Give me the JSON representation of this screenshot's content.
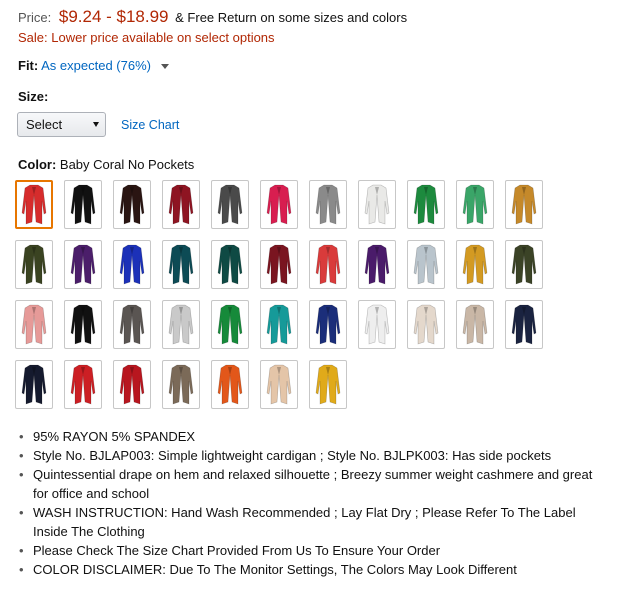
{
  "price": {
    "label": "Price:",
    "range": "$9.24 - $18.99",
    "free_return": "& Free Return on some sizes and colors"
  },
  "sale": {
    "text": "Sale:  Lower price available on select options"
  },
  "fit": {
    "label": "Fit:",
    "value": "As expected (76%)"
  },
  "size": {
    "label": "Size:",
    "select_value": "Select",
    "size_chart": "Size Chart"
  },
  "color": {
    "label": "Color:",
    "selected_name": "Baby Coral No Pockets"
  },
  "swatches": [
    {
      "color": "#d62c2c",
      "selected": true
    },
    {
      "color": "#111111"
    },
    {
      "color": "#2a1512"
    },
    {
      "color": "#8e1422"
    },
    {
      "color": "#4a4a4a"
    },
    {
      "color": "#d81e50"
    },
    {
      "color": "#8a8a8a"
    },
    {
      "color": "#e9e9e7"
    },
    {
      "color": "#1d8a3e"
    },
    {
      "color": "#3aa568"
    },
    {
      "color": "#c5892a"
    },
    {
      "color": "#3a4321"
    },
    {
      "color": "#4b1e6a"
    },
    {
      "color": "#1c31b8"
    },
    {
      "color": "#0d4b55"
    },
    {
      "color": "#0f4a44"
    },
    {
      "color": "#7a1520"
    },
    {
      "color": "#d93b3b"
    },
    {
      "color": "#4a1b6a"
    },
    {
      "color": "#b9c4cc"
    },
    {
      "color": "#d39a22"
    },
    {
      "color": "#3b4326"
    },
    {
      "color": "#e69a98"
    },
    {
      "color": "#111111"
    },
    {
      "color": "#5a5552"
    },
    {
      "color": "#c9c9c9"
    },
    {
      "color": "#168a3a"
    },
    {
      "color": "#169a99"
    },
    {
      "color": "#1b2e7a"
    },
    {
      "color": "#eeeeee"
    },
    {
      "color": "#e4d8cc"
    },
    {
      "color": "#c9b7a6"
    },
    {
      "color": "#1a2340"
    },
    {
      "color": "#151a2e"
    },
    {
      "color": "#cc1f24"
    },
    {
      "color": "#b8161f"
    },
    {
      "color": "#7b6a58"
    },
    {
      "color": "#e2571a"
    },
    {
      "color": "#e4c5a8"
    },
    {
      "color": "#e0aa1a"
    }
  ],
  "bullets": [
    "95% RAYON 5% SPANDEX",
    "Style No. BJLAP003: Simple lightweight cardigan ; Style No. BJLPK003: Has side pockets",
    "Quintessential drape on hem and relaxed silhouette ; Breezy summer weight cashmere and great for office and school",
    "WASH INSTRUCTION: Hand Wash Recommended ; Lay Flat Dry ; Please Refer To The Label Inside The Clothing",
    "Please Check The Size Chart Provided From Us To Ensure Your Order",
    "COLOR DISCLAIMER: Due To The Monitor Settings, The Colors May Look Different"
  ]
}
